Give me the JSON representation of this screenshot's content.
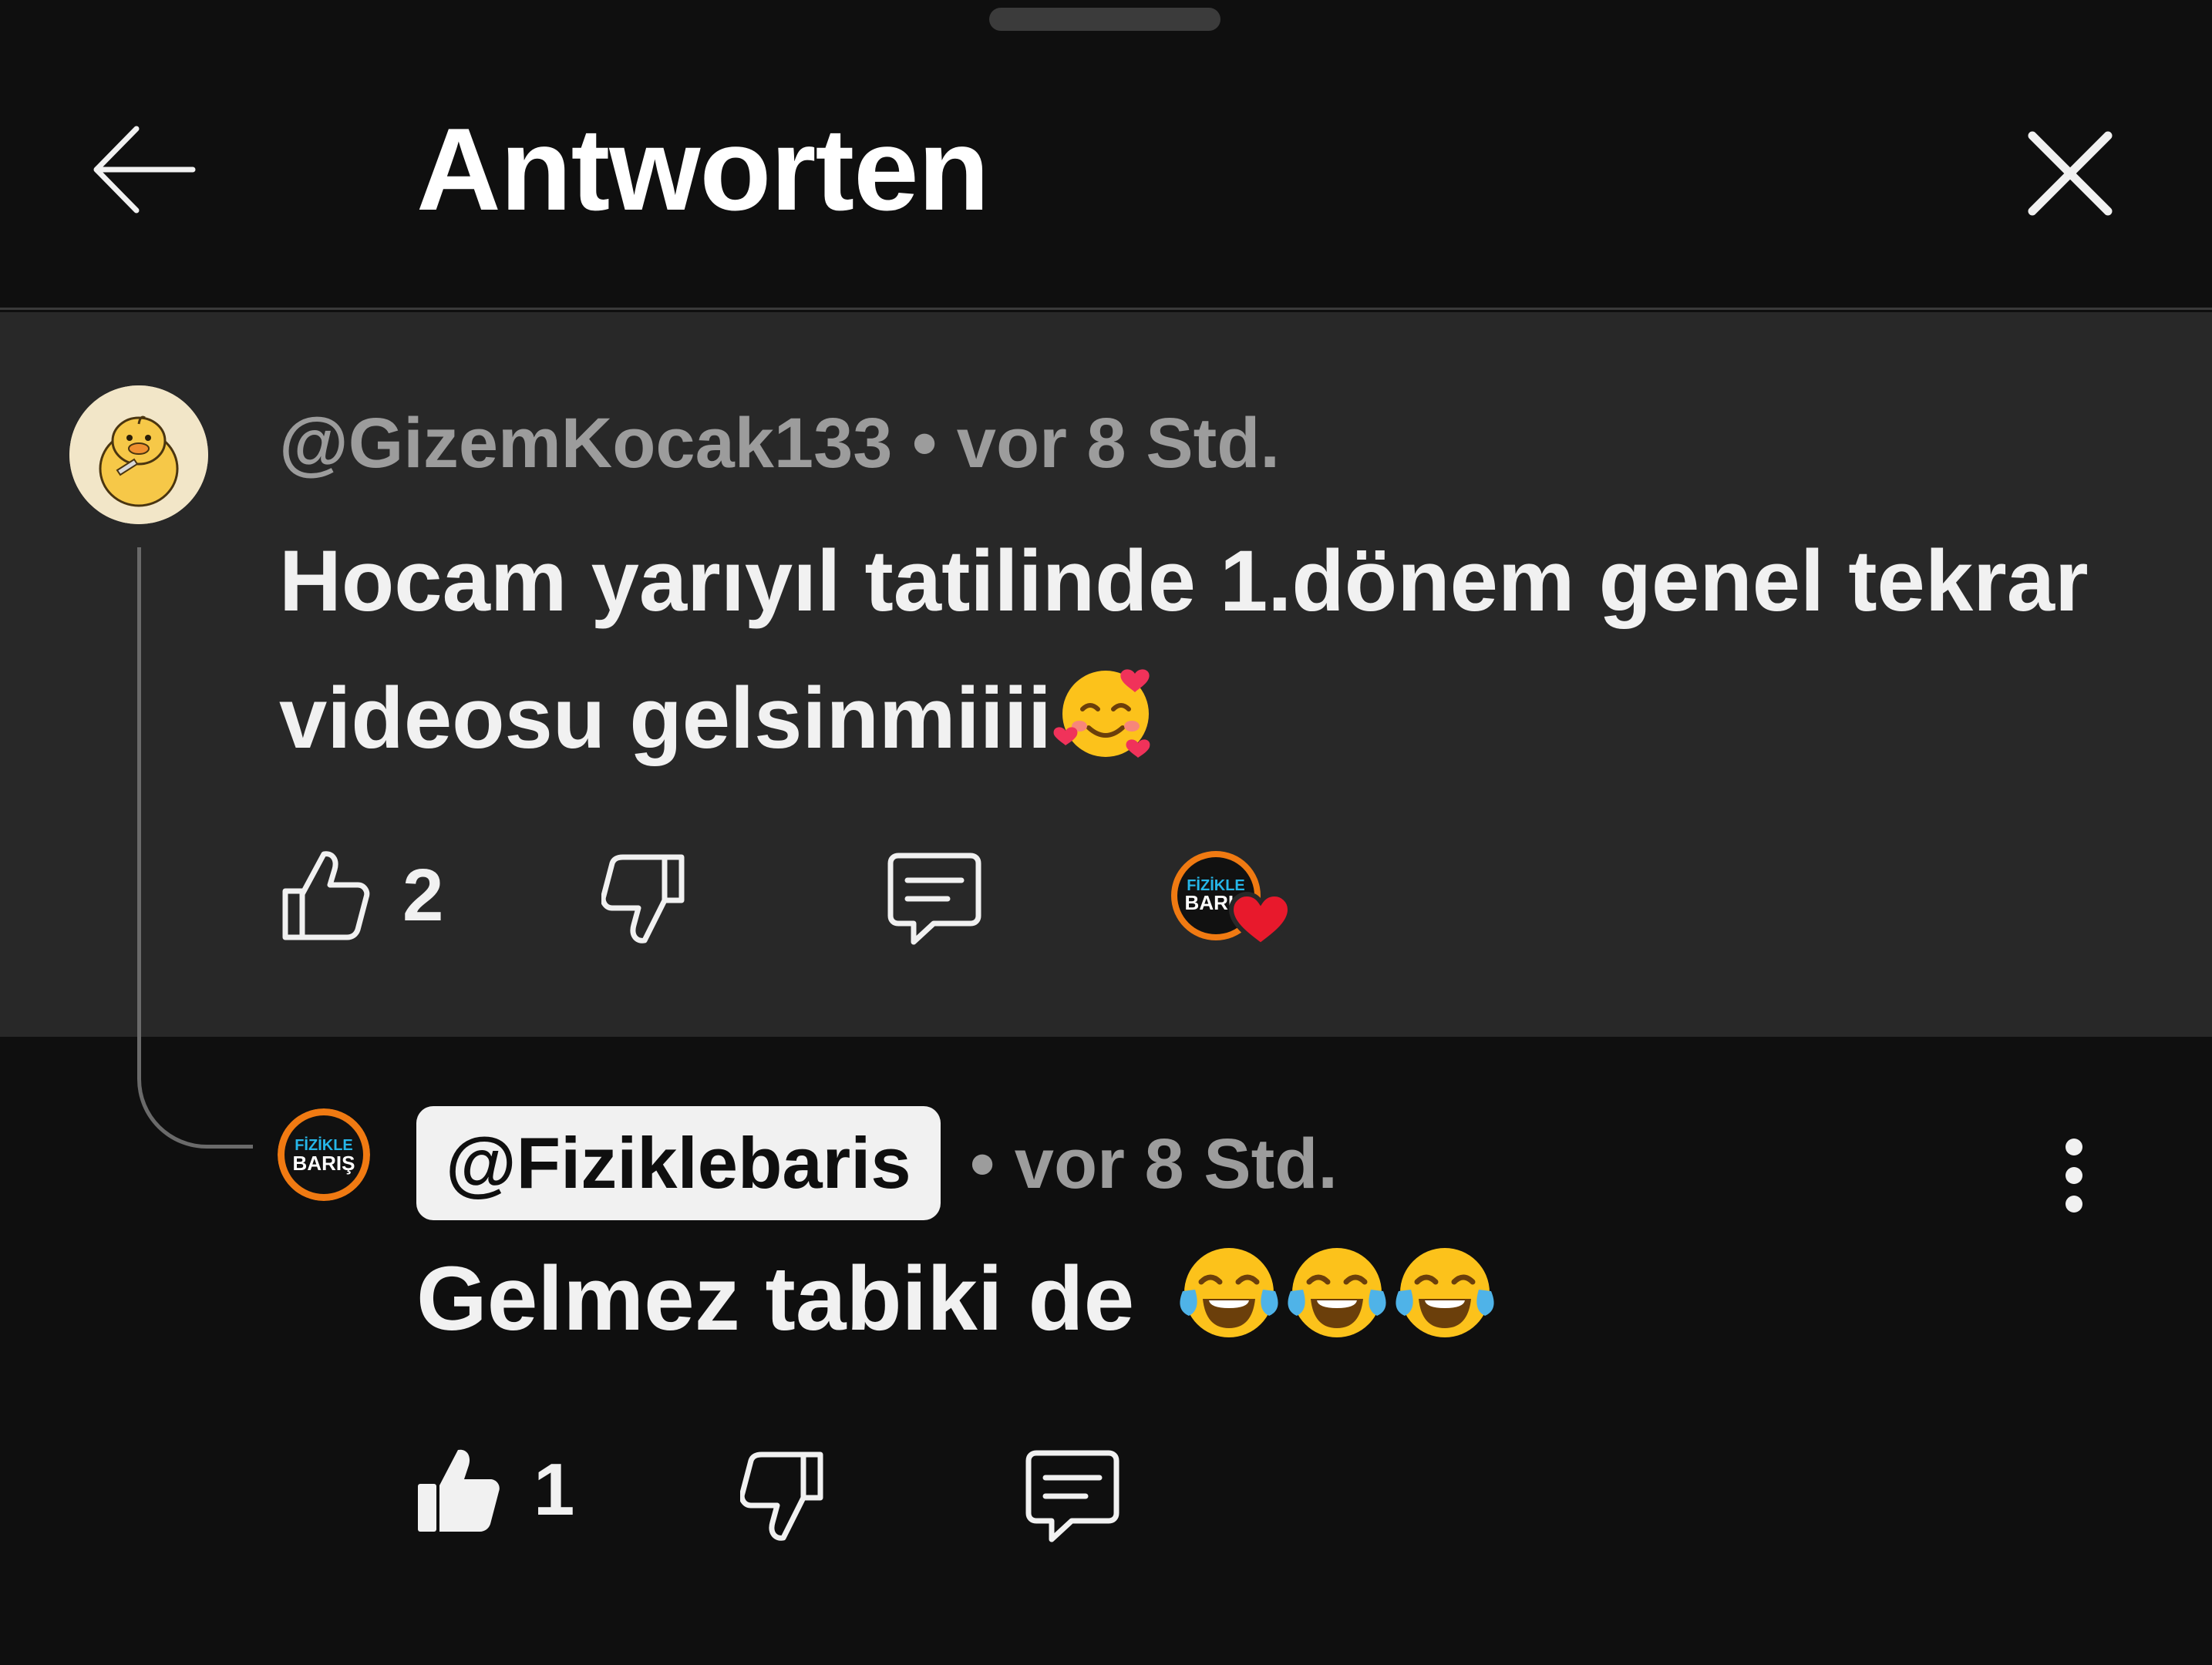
{
  "header": {
    "title": "Antworten"
  },
  "parent_comment": {
    "author": "@GizemKocak133",
    "separator": "•",
    "time": "vor 8 Std.",
    "text": "Hocam yarıyıl tatilinde 1.dönem genel tekrar videosu gelsinmiiii",
    "text_emoji": "smiling-face-with-hearts",
    "likes": "2",
    "creator_heart_avatar_text": [
      "FİZİKLE",
      "BARIŞ"
    ]
  },
  "reply": {
    "author": "@Fiziklebaris",
    "separator": "•",
    "time": "vor 8 Std.",
    "text": "Gelmez tabiki de",
    "text_emoji": [
      "face-with-tears-of-joy",
      "face-with-tears-of-joy",
      "face-with-tears-of-joy"
    ],
    "likes": "1",
    "avatar_text": [
      "FİZİKLE",
      "BARIŞ"
    ]
  },
  "colors": {
    "background": "#0f0f0f",
    "parent_background": "#282828",
    "meta_text": "#9c9c9c",
    "accent_orange": "#f07a12",
    "heart_red": "#e8192c"
  }
}
